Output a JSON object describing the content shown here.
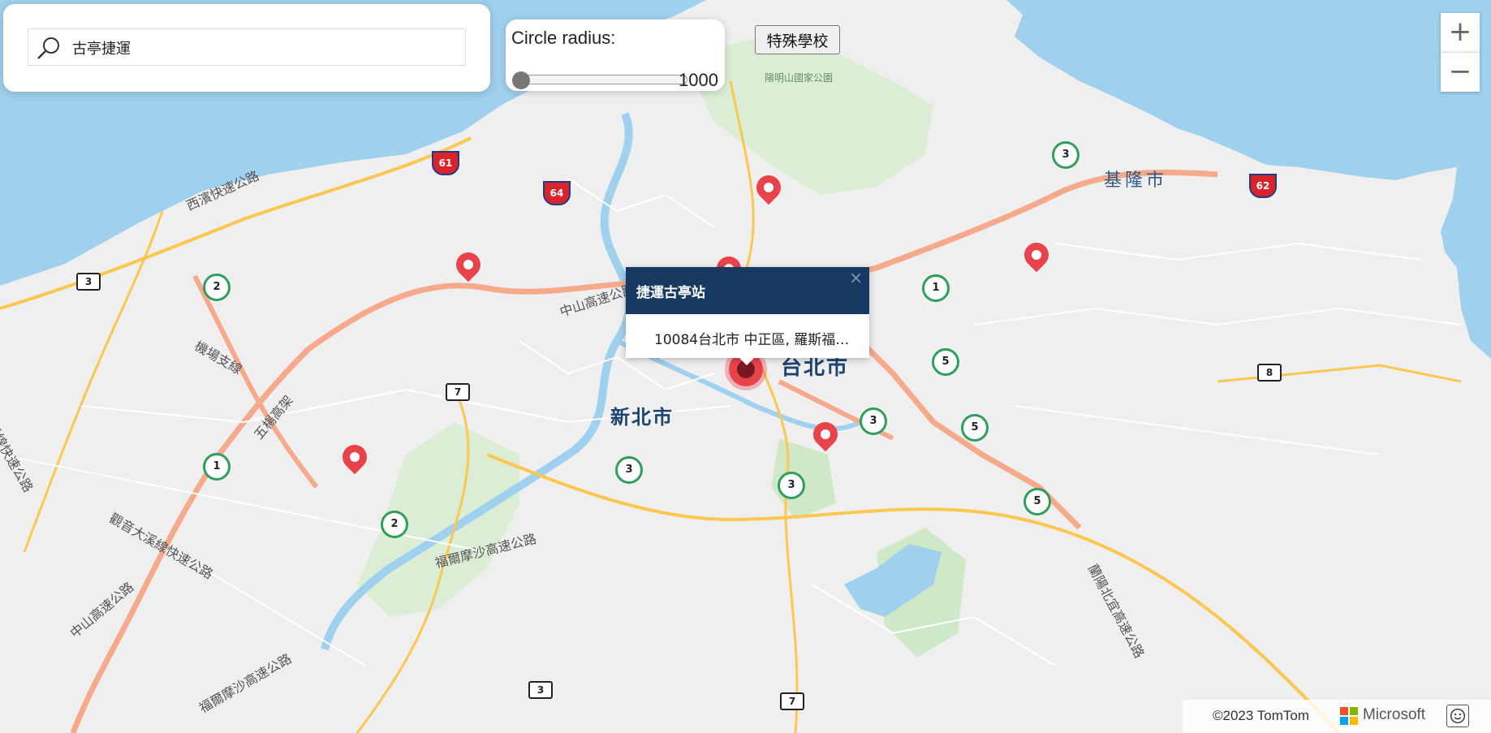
{
  "search": {
    "value": "古亭捷運",
    "placeholder": ""
  },
  "radius_control": {
    "label": "Circle radius:",
    "value": "1000",
    "fraction": 0.0
  },
  "special_button": {
    "label": "特殊學校"
  },
  "zoom": {
    "in": "+",
    "out": "−"
  },
  "popup": {
    "title": "捷運古亭站",
    "address": "10084台北市 中正區, 羅斯福…",
    "close": "×"
  },
  "map_labels": {
    "city_taipei": "台北市",
    "city_new_taipei": "新北市",
    "city_keelung": "基隆市",
    "park": "陽明山國家公園",
    "road_west_coast": "西濱快速公路",
    "road_zhongshan_1": "中山高速公路",
    "road_zhongshan_2": "中山高速公路",
    "road_airport_branch": "機場支線",
    "road_wuyang": "五楊高架",
    "road_fuer_1": "福爾摩沙高速公路",
    "road_fuer_2": "福爾摩沙高速公路",
    "road_guanyin": "觀音大溪線快速公路",
    "road_east_fragment": "溪線快速公路",
    "road_east": "蘭陽北宜高速公路"
  },
  "shields": {
    "h61": "61",
    "h64": "64",
    "h62": "62",
    "p3a": "3",
    "p7a": "7",
    "p8": "8",
    "p3b": "3",
    "p7b": "7",
    "f2a": "2",
    "f1a": "1",
    "f2b": "2",
    "f3a": "3",
    "f3b": "3",
    "f3c": "3",
    "f3d": "3",
    "f1b": "1",
    "f5a": "5",
    "f5b": "5",
    "f5c": "5"
  },
  "markers": [
    "marker",
    "marker",
    "marker",
    "marker",
    "marker",
    "marker",
    "marker",
    "selected-marker"
  ],
  "footer": {
    "copyright": "©2023 TomTom",
    "brand": "Microsoft"
  },
  "colors": {
    "water": "#9fd0ee",
    "land": "#f0f0f0",
    "park": "#cfe8c8",
    "motorway": "#f7a98c",
    "major_road": "#fcc74f",
    "pin": "#e8434a",
    "popup_header": "#173a63"
  }
}
